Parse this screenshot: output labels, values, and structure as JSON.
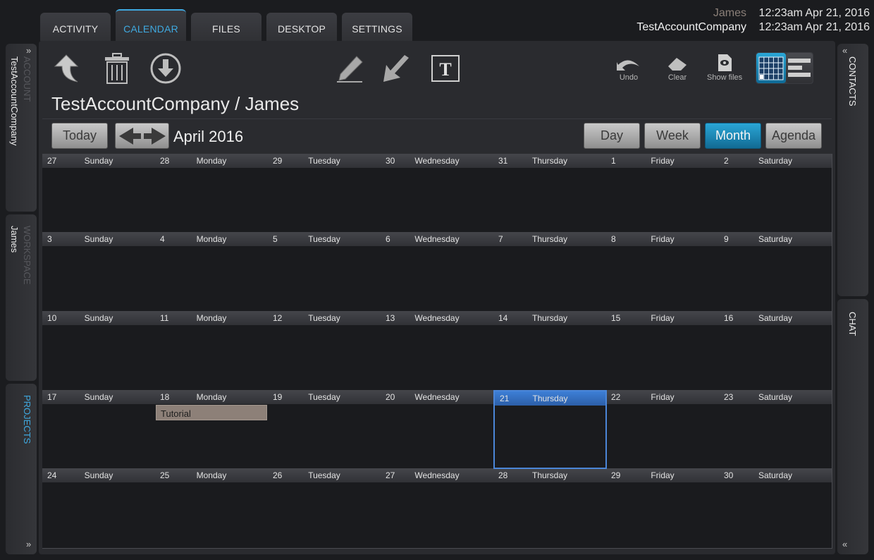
{
  "header": {
    "tabs": [
      {
        "label": "ACTIVITY",
        "active": false
      },
      {
        "label": "CALENDAR",
        "active": true
      },
      {
        "label": "FILES",
        "active": false
      },
      {
        "label": "DESKTOP",
        "active": false
      },
      {
        "label": "SETTINGS",
        "active": false
      }
    ],
    "user_rows": [
      {
        "name": "James",
        "time": "12:23am Apr 21, 2016"
      },
      {
        "name": "TestAccountCompany",
        "time": "12:23am Apr 21, 2016"
      }
    ]
  },
  "left_panel": {
    "account_label": "ACCOUNT",
    "account_value": "TestAccountCompany",
    "workspace_label": "WORKSPACE",
    "workspace_value": "James",
    "projects_label": "PROJECTS",
    "chevron": "»"
  },
  "right_panel": {
    "contacts_label": "CONTACTS",
    "chat_label": "CHAT",
    "chevron": "«"
  },
  "toolbar": {
    "undo_label": "Undo",
    "clear_label": "Clear",
    "show_files_label": "Show files",
    "icons": [
      "up-arrow-icon",
      "trash-icon",
      "download-icon",
      "pencil-icon",
      "pointer-arrow-icon",
      "text-tool-icon",
      "undo-icon",
      "eraser-icon",
      "show-files-icon",
      "month-grid-view-icon",
      "list-view-icon"
    ]
  },
  "breadcrumb": "TestAccountCompany / James",
  "nav": {
    "today_label": "Today",
    "month_title": "April 2016",
    "views": [
      {
        "label": "Day",
        "active": false
      },
      {
        "label": "Week",
        "active": false
      },
      {
        "label": "Month",
        "active": true
      },
      {
        "label": "Agenda",
        "active": false
      }
    ]
  },
  "calendar": {
    "day_names": [
      "Sunday",
      "Monday",
      "Tuesday",
      "Wednesday",
      "Thursday",
      "Friday",
      "Saturday"
    ],
    "weeks": [
      [
        "27",
        "28",
        "29",
        "30",
        "31",
        "1",
        "2"
      ],
      [
        "3",
        "4",
        "5",
        "6",
        "7",
        "8",
        "9"
      ],
      [
        "10",
        "11",
        "12",
        "13",
        "14",
        "15",
        "16"
      ],
      [
        "17",
        "18",
        "19",
        "20",
        "21",
        "22",
        "23"
      ],
      [
        "24",
        "25",
        "26",
        "27",
        "28",
        "29",
        "30"
      ]
    ],
    "today": {
      "week": 3,
      "day": 4
    },
    "events": [
      {
        "week": 3,
        "day": 1,
        "title": "Tutorial"
      }
    ]
  },
  "colors": {
    "accent": "#3fa9e0",
    "today_border": "#4b86d8",
    "event_bg": "#8d8078"
  }
}
